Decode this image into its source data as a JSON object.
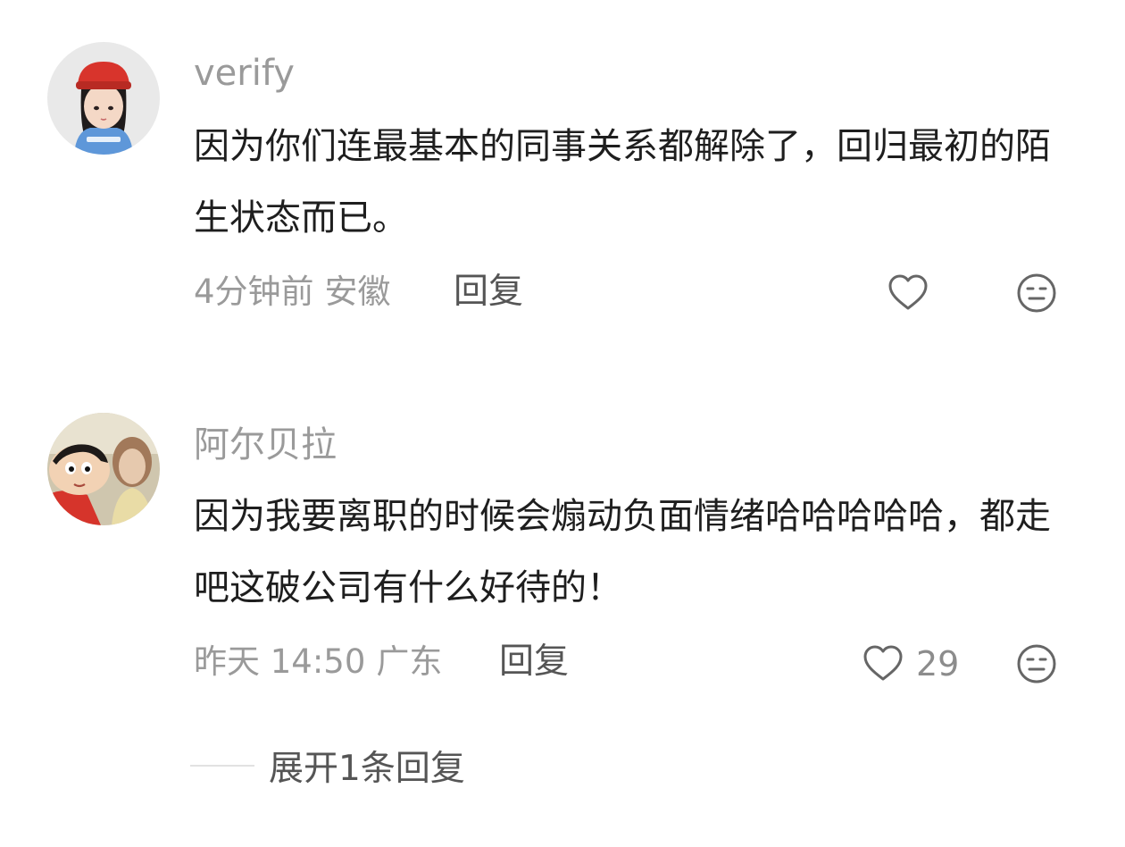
{
  "comments": [
    {
      "username": "verify",
      "text": "因为你们连最基本的同事关系都解除了，回归最初的陌生状态而已。",
      "time": "4分钟前",
      "location": "安徽",
      "reply_label": "回复",
      "like_count": "",
      "avatar_icon": "girl-red-hat-avatar"
    },
    {
      "username": "阿尔贝拉",
      "text": "因为我要离职的时候会煽动负面情绪哈哈哈哈哈，都走吧这破公司有什么好待的！",
      "time": "昨天 14:50",
      "location": "广东",
      "reply_label": "回复",
      "like_count": "29",
      "avatar_icon": "crayon-shinchan-avatar"
    }
  ],
  "expand_replies_label": "展开1条回复",
  "colors": {
    "text_primary": "#1e1e1e",
    "text_secondary": "#9a9a9a",
    "reply": "#555555",
    "icon": "#666666"
  }
}
